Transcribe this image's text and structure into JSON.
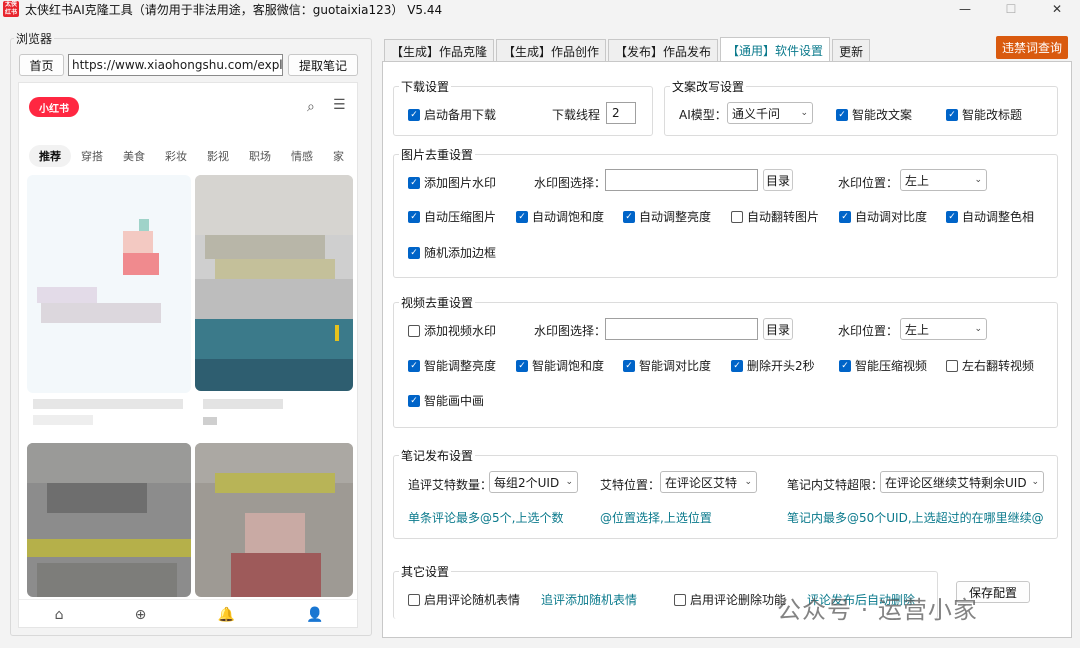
{
  "window": {
    "app_icon_text": "太侠\n红书",
    "title": "太侠红书AI克隆工具（请勿用于非法用途，客服微信：guotaixia123） V5.44",
    "min_icon": "—",
    "max_icon": "☐",
    "close_icon": "✕"
  },
  "browser": {
    "label": "浏览器",
    "home_btn": "首页",
    "url": "https://www.xiaohongshu.com/explor",
    "fetch_btn": "提取笔记",
    "logo": "小红书",
    "tabs": [
      "推荐",
      "穿搭",
      "美食",
      "彩妆",
      "影视",
      "职场",
      "情感",
      "家"
    ],
    "bottom_icons": [
      "⌂",
      "⊕",
      "🔔",
      "👤"
    ]
  },
  "tabs": [
    "【生成】作品克隆",
    "【生成】作品创作",
    "【发布】作品发布",
    "【通用】软件设置",
    "更新"
  ],
  "active_tab": 3,
  "ban_word_btn": "违禁词查询",
  "download": {
    "title": "下载设置",
    "backup_download": "启动备用下载",
    "threads_label": "下载线程",
    "threads_value": "2"
  },
  "rewrite": {
    "title": "文案改写设置",
    "ai_model_label": "AI模型：",
    "ai_model_value": "通义千问",
    "smart_copy": "智能改文案",
    "smart_title": "智能改标题"
  },
  "image": {
    "title": "图片去重设置",
    "add_watermark": "添加图片水印",
    "wm_select_label": "水印图选择：",
    "dir_btn": "目录",
    "wm_pos_label": "水印位置：",
    "wm_pos_value": "左上",
    "opt1": "自动压缩图片",
    "opt2": "自动调饱和度",
    "opt3": "自动调整亮度",
    "opt4": "自动翻转图片",
    "opt5": "自动调对比度",
    "opt6": "自动调整色相",
    "opt7": "随机添加边框"
  },
  "video": {
    "title": "视频去重设置",
    "add_watermark": "添加视频水印",
    "wm_select_label": "水印图选择：",
    "dir_btn": "目录",
    "wm_pos_label": "水印位置：",
    "wm_pos_value": "左上",
    "opt1": "智能调整亮度",
    "opt2": "智能调饱和度",
    "opt3": "智能调对比度",
    "opt4": "删除开头2秒",
    "opt5": "智能压缩视频",
    "opt6": "左右翻转视频",
    "opt7": "智能画中画"
  },
  "publish": {
    "title": "笔记发布设置",
    "follow_count_label": "追评艾特数量：",
    "follow_count_value": "每组2个UID",
    "at_pos_label": "艾特位置：",
    "at_pos_value": "在评论区艾特",
    "limit_label": "笔记内艾特超限：",
    "limit_value": "在评论区继续艾特剩余UID",
    "hint1": "单条评论最多@5个,上选个数",
    "hint2": "@位置选择,上选位置",
    "hint3": "笔记内最多@50个UID,上选超过的在哪里继续@"
  },
  "other": {
    "title": "其它设置",
    "random_emoji": "启用评论随机表情",
    "random_emoji_hint": "追评添加随机表情",
    "delete_comment": "启用评论删除功能",
    "delete_hint": "评论发布后自动删除",
    "save_btn": "保存配置"
  },
  "watermark_overlay": "公众号 · 运营小家",
  "colors": {
    "accent": "#0064c8",
    "teal": "#0b7a8c",
    "orange": "#d95a0f",
    "xhs_red": "#ff2741"
  }
}
